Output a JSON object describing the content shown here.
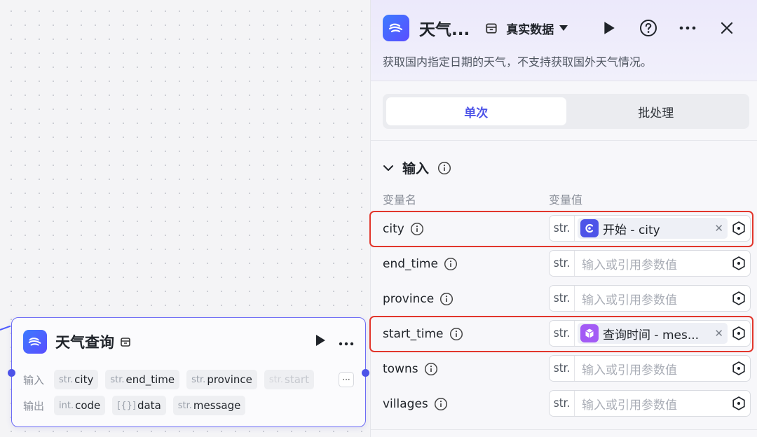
{
  "canvas": {
    "node": {
      "title": "天气查询",
      "input_label": "输入",
      "output_label": "输出",
      "inputs": [
        {
          "type": "str.",
          "name": "city"
        },
        {
          "type": "str.",
          "name": "end_time"
        },
        {
          "type": "str.",
          "name": "province"
        },
        {
          "type": "str.",
          "name": "start"
        }
      ],
      "outputs": [
        {
          "type": "int.",
          "name": "code"
        },
        {
          "type": "[{}]",
          "name": "data"
        },
        {
          "type": "str.",
          "name": "message"
        }
      ],
      "more_label": "···"
    }
  },
  "panel": {
    "title": "天气...",
    "data_mode": "真实数据",
    "description": "获取国内指定日期的天气，不支持获取国外天气情况。",
    "tabs": [
      {
        "label": "单次",
        "active": true
      },
      {
        "label": "批处理",
        "active": false
      }
    ],
    "section_title": "输入",
    "col_name": "变量名",
    "col_value": "变量值",
    "params": [
      {
        "name": "city",
        "type": "str.",
        "ref_source": "开始",
        "ref_text": "开始 - city",
        "ref_color": "#4d53e8",
        "highlight": true
      },
      {
        "name": "end_time",
        "type": "str.",
        "placeholder": "输入或引用参数值"
      },
      {
        "name": "province",
        "type": "str.",
        "placeholder": "输入或引用参数值"
      },
      {
        "name": "start_time",
        "type": "str.",
        "ref_source": "查询时间",
        "ref_text": "查询时间 - mes...",
        "ref_color": "#a35bf5",
        "highlight": true
      },
      {
        "name": "towns",
        "type": "str.",
        "placeholder": "输入或引用参数值"
      },
      {
        "name": "villages",
        "type": "str.",
        "placeholder": "输入或引用参数值"
      }
    ]
  },
  "colors": {
    "accent": "#4d53e8",
    "highlight": "#e2362c"
  }
}
